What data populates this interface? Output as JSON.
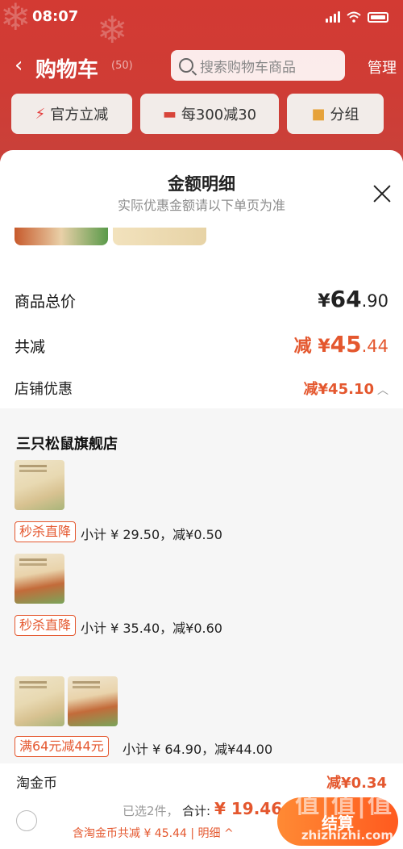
{
  "status": {
    "time": "08:07"
  },
  "header": {
    "title": "购物车",
    "count": "(50)",
    "search_placeholder": "搜索购物车商品",
    "manage": "管理"
  },
  "chips": [
    {
      "icon": "lightning-icon",
      "label": "官方立减"
    },
    {
      "icon": "coupon-icon",
      "label": "每300减30"
    },
    {
      "icon": "folder-icon",
      "label": "分组"
    }
  ],
  "sheet": {
    "title": "金额明细",
    "subtitle": "实际优惠金额请以下单页为准",
    "total_label": "商品总价",
    "total_currency": "¥",
    "total_int": "64",
    "total_dec": ".90",
    "reduce_label": "共减",
    "reduce_prefix": "减 ¥",
    "reduce_int": "45",
    "reduce_dec": ".44",
    "shop_label": "店铺优惠",
    "shop_value": "减¥45.10"
  },
  "detail": {
    "store": "三只松鼠旗舰店",
    "groups": [
      {
        "tag": "秒杀直降",
        "subtotal": "小计 ¥ 29.50，减¥0.50"
      },
      {
        "tag": "秒杀直降",
        "subtotal": "小计 ¥ 35.40，减¥0.60"
      },
      {
        "tag": "满64元减44元",
        "subtotal": "小计 ¥ 64.90，减¥44.00"
      }
    ],
    "gold_label": "淘金币",
    "gold_value": "减¥0.34"
  },
  "bottom": {
    "selected": "已选2件，",
    "sum_label": "合计:",
    "sum_value": "¥ 19.46",
    "gold_info": "含淘金币共减 ¥ 45.44 | 明细 ^",
    "checkout": "结算"
  },
  "watermark": {
    "text": "zhizhizhi.com",
    "big": "值|值|值"
  },
  "colors": {
    "brand_red": "#d33a33",
    "accent": "#e4572e",
    "checkout": "#ff6a24"
  }
}
